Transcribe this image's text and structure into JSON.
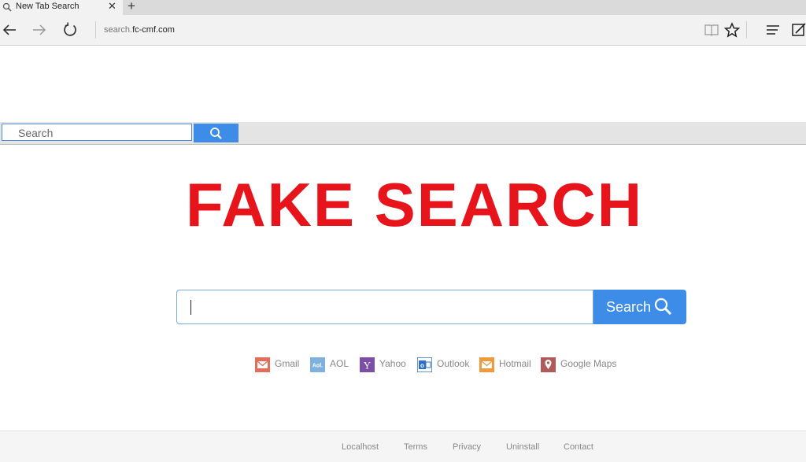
{
  "browser": {
    "tab_title": "New Tab Search",
    "close_glyph": "✕",
    "newtab_glyph": "+",
    "url_prefix": "search.",
    "url_domain": "fc-cmf.com"
  },
  "strip": {
    "placeholder": "Search"
  },
  "hero": {
    "title": "FAKE SEARCH"
  },
  "main_search": {
    "button_label": "Search"
  },
  "quick_links": [
    {
      "label": "Gmail",
      "icon": "gmail-icon",
      "color": "#e46c5a"
    },
    {
      "label": "AOL",
      "icon": "aol-icon",
      "color": "#7fb1de"
    },
    {
      "label": "Yahoo",
      "icon": "yahoo-icon",
      "color": "#7b4fa6"
    },
    {
      "label": "Outlook",
      "icon": "outlook-icon",
      "color": "#2f72c4"
    },
    {
      "label": "Hotmail",
      "icon": "hotmail-icon",
      "color": "#ef9a3c"
    },
    {
      "label": "Google Maps",
      "icon": "google-maps-icon",
      "color": "#b05a5a"
    }
  ],
  "footer": {
    "links": [
      "Localhost",
      "Terms",
      "Privacy",
      "Uninstall",
      "Contact"
    ]
  },
  "colors": {
    "accent": "#3d8de8",
    "title_red": "#e8141b"
  }
}
